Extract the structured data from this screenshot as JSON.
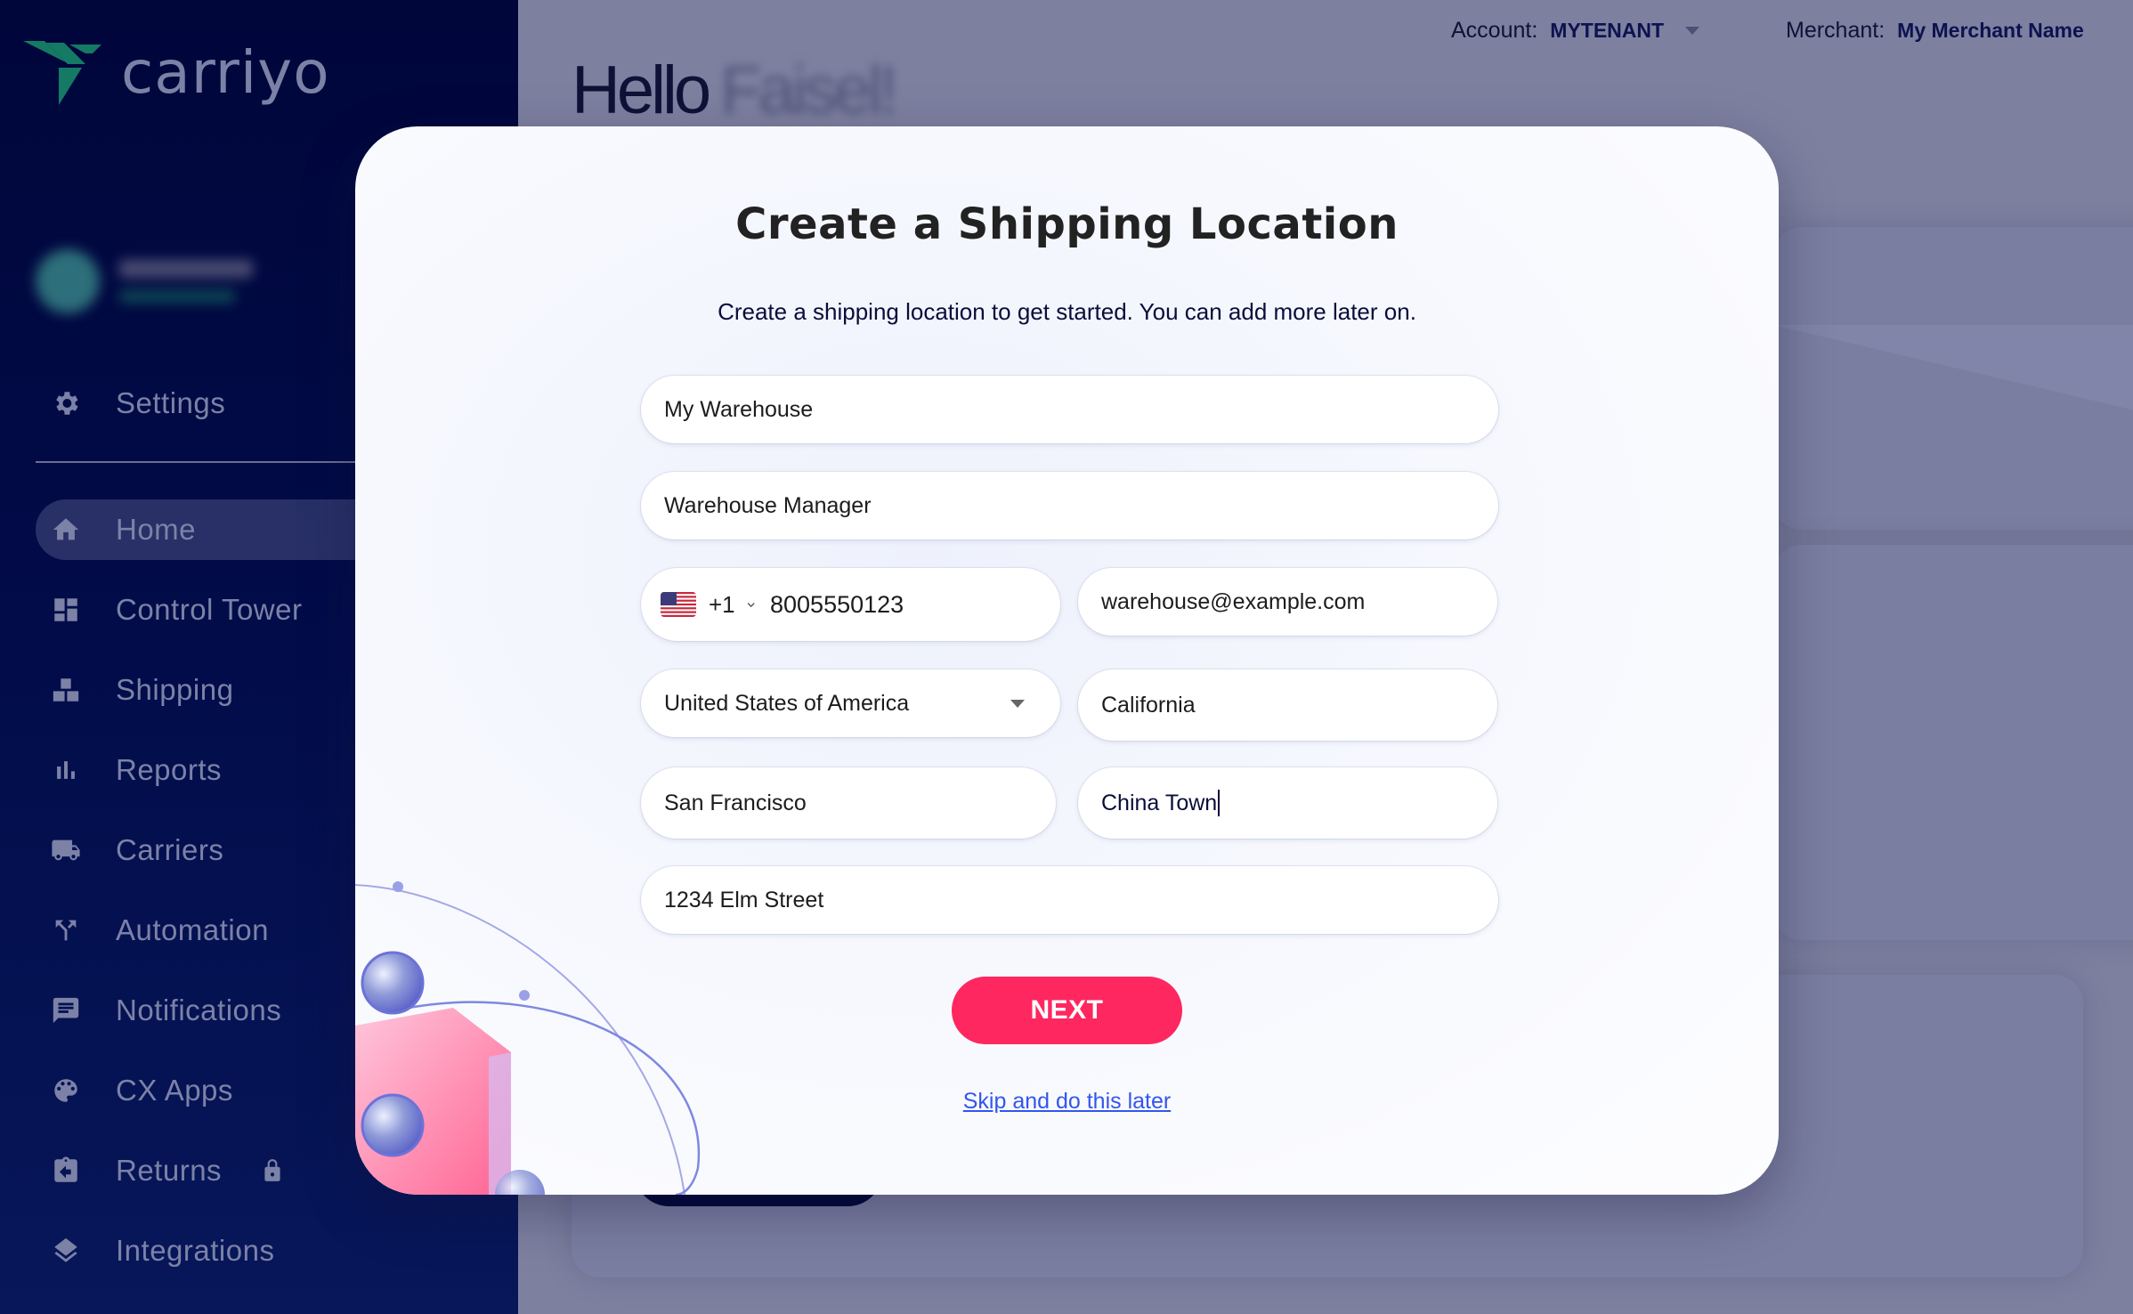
{
  "brand": {
    "name": "carriyo",
    "logo_color": "#147a64"
  },
  "user": {
    "name": "Faisel Azeez",
    "role": "Super Admin",
    "blurred": true
  },
  "header": {
    "account_label": "Account:",
    "account_value": "MYTENANT",
    "merchant_label": "Merchant:",
    "merchant_value": "My Merchant Name",
    "greeting": "Hello",
    "greeting_name": "Faisel!"
  },
  "sidebar": {
    "settings": {
      "label": "Settings",
      "icon": "gear-icon"
    },
    "items": [
      {
        "label": "Home",
        "icon": "home-icon",
        "active": true
      },
      {
        "label": "Control Tower",
        "icon": "dashboard-icon",
        "active": false
      },
      {
        "label": "Shipping",
        "icon": "boxes-icon",
        "active": false
      },
      {
        "label": "Reports",
        "icon": "bar-chart-icon",
        "active": false
      },
      {
        "label": "Carriers",
        "icon": "truck-icon",
        "active": false
      },
      {
        "label": "Automation",
        "icon": "split-arrows-icon",
        "active": false
      },
      {
        "label": "Notifications",
        "icon": "chat-icon",
        "active": false
      },
      {
        "label": "CX Apps",
        "icon": "palette-icon",
        "active": false
      },
      {
        "label": "Returns",
        "icon": "return-clipboard-icon",
        "active": false,
        "locked": true
      },
      {
        "label": "Integrations",
        "icon": "layers-icon",
        "active": false
      }
    ]
  },
  "modal": {
    "title": "Create a Shipping Location",
    "subtitle": "Create a shipping location to get started. You can add more later on.",
    "fields": {
      "location_name": "My Warehouse",
      "contact_name": "Warehouse Manager",
      "phone_country": "US",
      "phone_dial_code": "+1",
      "phone_number": "8005550123",
      "email": "warehouse@example.com",
      "country": "United States of America",
      "state": "California",
      "city": "San Francisco",
      "area": "China Town",
      "street": "1234 Elm Street"
    },
    "next_label": "NEXT",
    "skip_label": "Skip and do this later"
  },
  "colors": {
    "sidebar_bg": "#00063a",
    "primary_button": "#fe2760",
    "link": "#3355ee",
    "overlay": "#7d809f"
  }
}
